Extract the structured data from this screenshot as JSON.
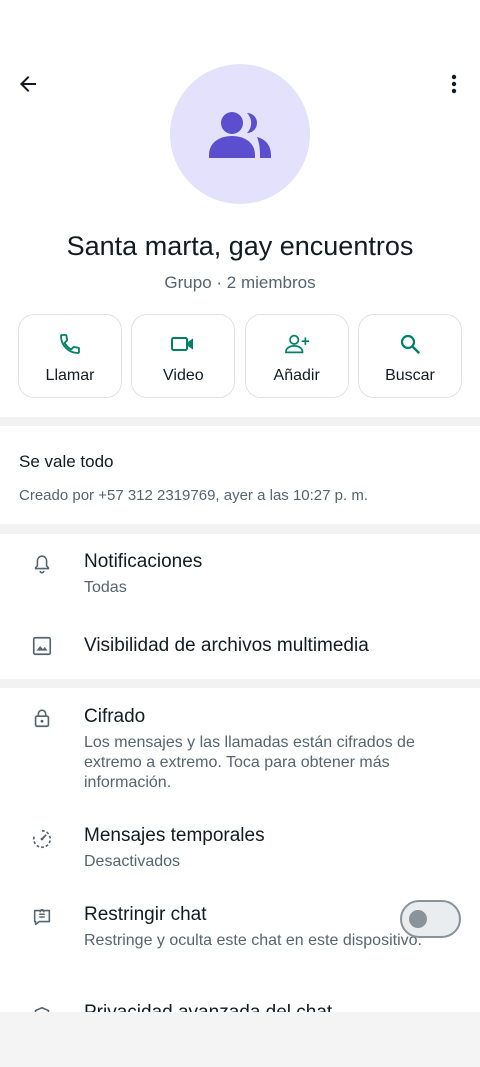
{
  "header": {
    "back_icon": "arrow-back-icon",
    "menu_icon": "more-vert-icon"
  },
  "avatar": {
    "icon": "group-icon",
    "bg_color": "#e3e1fb",
    "icon_color": "#5b4ecf"
  },
  "group": {
    "name": "Santa marta, gay encuentros",
    "subtitle": "Grupo · 2 miembros"
  },
  "actions": [
    {
      "label": "Llamar",
      "icon": "phone-icon"
    },
    {
      "label": "Video",
      "icon": "videocam-icon"
    },
    {
      "label": "Añadir",
      "icon": "add-person-icon"
    },
    {
      "label": "Buscar",
      "icon": "search-icon"
    }
  ],
  "accent_color": "#008069",
  "description": {
    "title": "Se vale todo",
    "created": "Creado por +57 312 2319769, ayer a las 10:27 p. m."
  },
  "settings": {
    "notifications": {
      "title": "Notificaciones",
      "subtitle": "Todas",
      "icon": "bell-icon"
    },
    "media_visibility": {
      "title": "Visibilidad de archivos multimedia",
      "icon": "image-icon"
    },
    "encryption": {
      "title": "Cifrado",
      "subtitle": "Los mensajes y las llamadas están cifrados de extremo a extremo. Toca para obtener más información.",
      "icon": "lock-icon"
    },
    "disappearing": {
      "title": "Mensajes temporales",
      "subtitle": "Desactivados",
      "icon": "timer-icon"
    },
    "chat_lock": {
      "title": "Restringir chat",
      "subtitle": "Restringe y oculta este chat en este dispositivo.",
      "icon": "chat-lock-icon",
      "enabled": false
    },
    "partial_row_title": "Privacidad avanzada del chat"
  }
}
